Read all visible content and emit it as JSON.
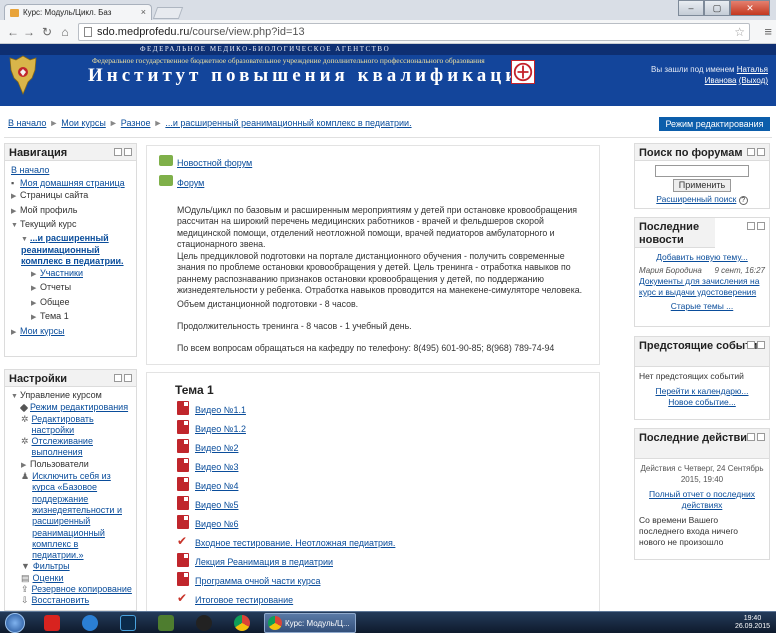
{
  "browser": {
    "tab_title": "Курс: Модуль/Цикл. Баз",
    "close_glyph": "×",
    "url_host": "sdo.medprofedu.ru",
    "url_path": "/course/view.php?id=13"
  },
  "header": {
    "agency": "ФЕДЕРАЛЬНОЕ МЕДИКО-БИОЛОГИЧЕСКОЕ АГЕНТСТВО",
    "subtitle": "Федеральное государственное бюджетное образовательное учреждение дополнительного профессионального образования",
    "title": "Институт повышения квалификации",
    "login_prefix": "Вы зашли под именем",
    "login_user": "Наталья Иванова",
    "logout": "(Выход)"
  },
  "breadcrumb": {
    "items": [
      "В начало",
      "Мои курсы",
      "Разное",
      "...и расширенный реанимационный комплекс в педиатрии."
    ],
    "separator": "►",
    "edit_mode": "Режим редактирования"
  },
  "navigation": {
    "title": "Навигация",
    "home": "В начало",
    "items": [
      "Моя домашняя страница",
      "Страницы сайта",
      "Мой профиль",
      "Текущий курс"
    ],
    "course_name": "...и расширенный реанимационный комплекс в педиатрии.",
    "course_items": [
      "Участники",
      "Отчеты",
      "Общее",
      "Тема 1"
    ],
    "my_courses": "Мои курсы"
  },
  "settings": {
    "title": "Настройки",
    "manage": "Управление курсом",
    "items": [
      "Режим редактирования",
      "Редактировать настройки",
      "Отслеживание выполнения",
      "Пользователи",
      "Исключить себя из курса «Базовое поддержание жизнедеятельности и расширенный реанимационный комплекс в педиатрии.»",
      "Фильтры",
      "Оценки",
      "Резервное копирование",
      "Восстановить"
    ]
  },
  "center": {
    "forum_news": "Новостной форум",
    "forum": "Форум",
    "para1": "МОдуль/цикл по базовым и расширенным мероприятиям у детей при остановке кровообращения рассчитан на широкий перечень медицинских работников - врачей и фельдшеров скорой медицинской помощи, отделений неотложной помощи, врачей педиаторов амбулаторного и стационарного звена.",
    "para2": "Цель предцикловой подготовки на портале дистанционного обучения - получить современные знания по проблеме остановки кровообращения у детей. Цель тренинга - отработка навыков по раннему распознаванию  признаков остановки кровообращения у детей, по поддержанию жизнедеятельности у ребенка.  Отработка навыков проводится на манекене-симуляторе человека.",
    "para3": "Объем дистанционной подготовки - 8 часов.",
    "para4": "Продолжительность тренинга - 8 часов - 1 учебный день.",
    "para5": "По всем вопросам обращаться на кафедру по телефону: 8(495) 601-90-85; 8(968) 789-74-94",
    "section_title": "Тема 1",
    "resources": [
      "Видео №1.1",
      "Видео №1.2",
      "Видео №2",
      "Видео №3",
      "Видео №4",
      "Видео №5",
      "Видео №6",
      "Входное тестирование. Неотложная педиатрия.",
      "Лекция Реанимация в педиатрии",
      "Программа очной части курса",
      "Итоговое тестирование"
    ]
  },
  "search_block": {
    "title": "Поиск по форумам",
    "button": "Применить",
    "advanced": "Расширенный поиск",
    "help_glyph": "?"
  },
  "news_block": {
    "title": "Последние новости",
    "add": "Добавить новую тему...",
    "author": "Мария Бородина",
    "date": "9 сент, 16:27",
    "headline": "Документы для зачисления на курс и выдачи удостоверения",
    "old": "Старые темы ..."
  },
  "events_block": {
    "title": "Предстоящие события",
    "none": "Нет предстоящих событий",
    "calendar": "Перейти к календарю...",
    "new_event": "Новое событие..."
  },
  "activity_block": {
    "title": "Последние действия",
    "since": "Действия с Четверг, 24 Сентябрь 2015, 19:40",
    "report": "Полный отчет о последних действиях",
    "nothing": "Со времени Вашего последнего входа ничего нового не произошло"
  },
  "taskbar": {
    "active_window": "Курс: Модуль/Ц...",
    "time": "19:40",
    "date": "26.09.2015"
  },
  "colors": {
    "header_blue": "#13459b",
    "link": "#0a4d9b",
    "edit_button": "#0c5eab"
  }
}
